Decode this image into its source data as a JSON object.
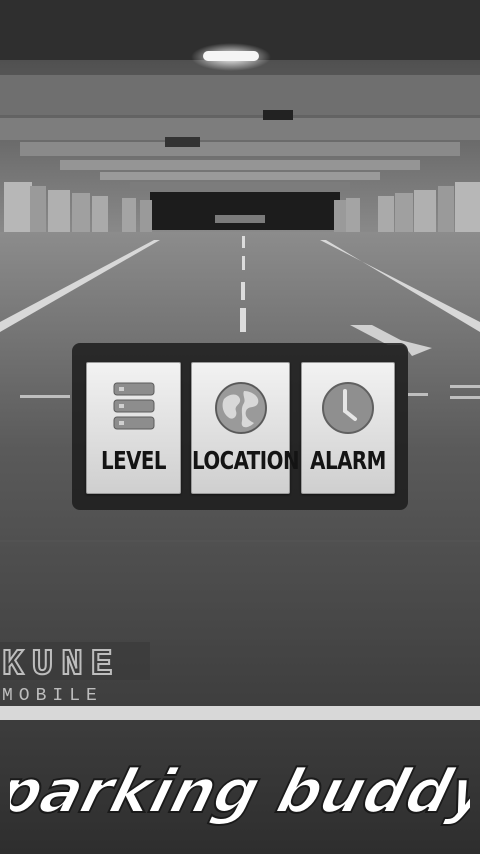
{
  "menu": {
    "level_label": "LEVEL",
    "location_label": "LOCATION",
    "alarm_label": "ALARM"
  },
  "icons": {
    "level": "stack-list-icon",
    "location": "globe-icon",
    "alarm": "clock-icon"
  },
  "brand": {
    "company_line1": "KUNE",
    "company_line2": "MOBILE",
    "app_title": "parking buddy"
  }
}
